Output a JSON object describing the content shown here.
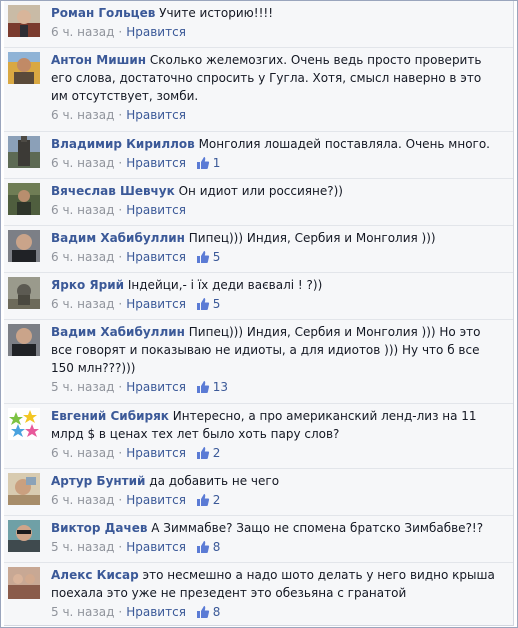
{
  "comments": [
    {
      "author": "Роман Гольцев",
      "text": "Учите историю!!!!",
      "time": "6 ч. назад",
      "like_label": "Нравится",
      "likes": ""
    },
    {
      "author": "Антон Мишин",
      "text": "Сколько желемозгих. Очень ведь просто проверить его слова, достаточно спросить у Гугла. Хотя, смысл наверно в это им отсутствует, зомби.",
      "time": "6 ч. назад",
      "like_label": "Нравится",
      "likes": ""
    },
    {
      "author": "Владимир Кириллов",
      "text": "Монголия лошадей поставляла. Очень много.",
      "time": "6 ч. назад",
      "like_label": "Нравится",
      "likes": "1"
    },
    {
      "author": "Вячеслав Шевчук",
      "text": "Он идиот или россияне?))",
      "time": "6 ч. назад",
      "like_label": "Нравится",
      "likes": ""
    },
    {
      "author": "Вадим Хабибуллин",
      "text": "Пипец))) Индия, Сербия и Монголия )))",
      "time": "6 ч. назад",
      "like_label": "Нравится",
      "likes": "5"
    },
    {
      "author": "Ярко Ярий",
      "text": "Індейци,- і їх деди ваєвалі ! ?))",
      "time": "6 ч. назад",
      "like_label": "Нравится",
      "likes": "5"
    },
    {
      "author": "Вадим Хабибуллин",
      "text": "Пипец))) Индия, Сербия и Монголия ))) Но это все говорят и показываю не идиоты, а для идиотов ))) Ну что б все 150 млн???)))",
      "time": "5 ч. назад",
      "like_label": "Нравится",
      "likes": "13"
    },
    {
      "author": "Евгений Сибиряк",
      "text": "Интересно, а про американский ленд-лиз на 11 млрд $ в ценах тех лет было хоть пару слов?",
      "time": "6 ч. назад",
      "like_label": "Нравится",
      "likes": "2"
    },
    {
      "author": "Артур Бунтий",
      "text": "да добавить не чего",
      "time": "6 ч. назад",
      "like_label": "Нравится",
      "likes": "2"
    },
    {
      "author": "Виктор Дачев",
      "text": "А Зиммабве? Защо не спомена братско Зимбабве?!?",
      "time": "5 ч. назад",
      "like_label": "Нравится",
      "likes": "8"
    },
    {
      "author": "Алекс Кисар",
      "text": "это несмешно а надо шото делать у него видно крыша поехала это уже не презедент это обезьяна с гранатой",
      "time": "5 ч. назад",
      "like_label": "Нравится",
      "likes": "8"
    }
  ],
  "colors": {
    "author": "#3b5998",
    "meta": "#90949c",
    "comment_bg": "#f6f7f9"
  },
  "icons": {
    "like": "thumbs-up-icon"
  }
}
